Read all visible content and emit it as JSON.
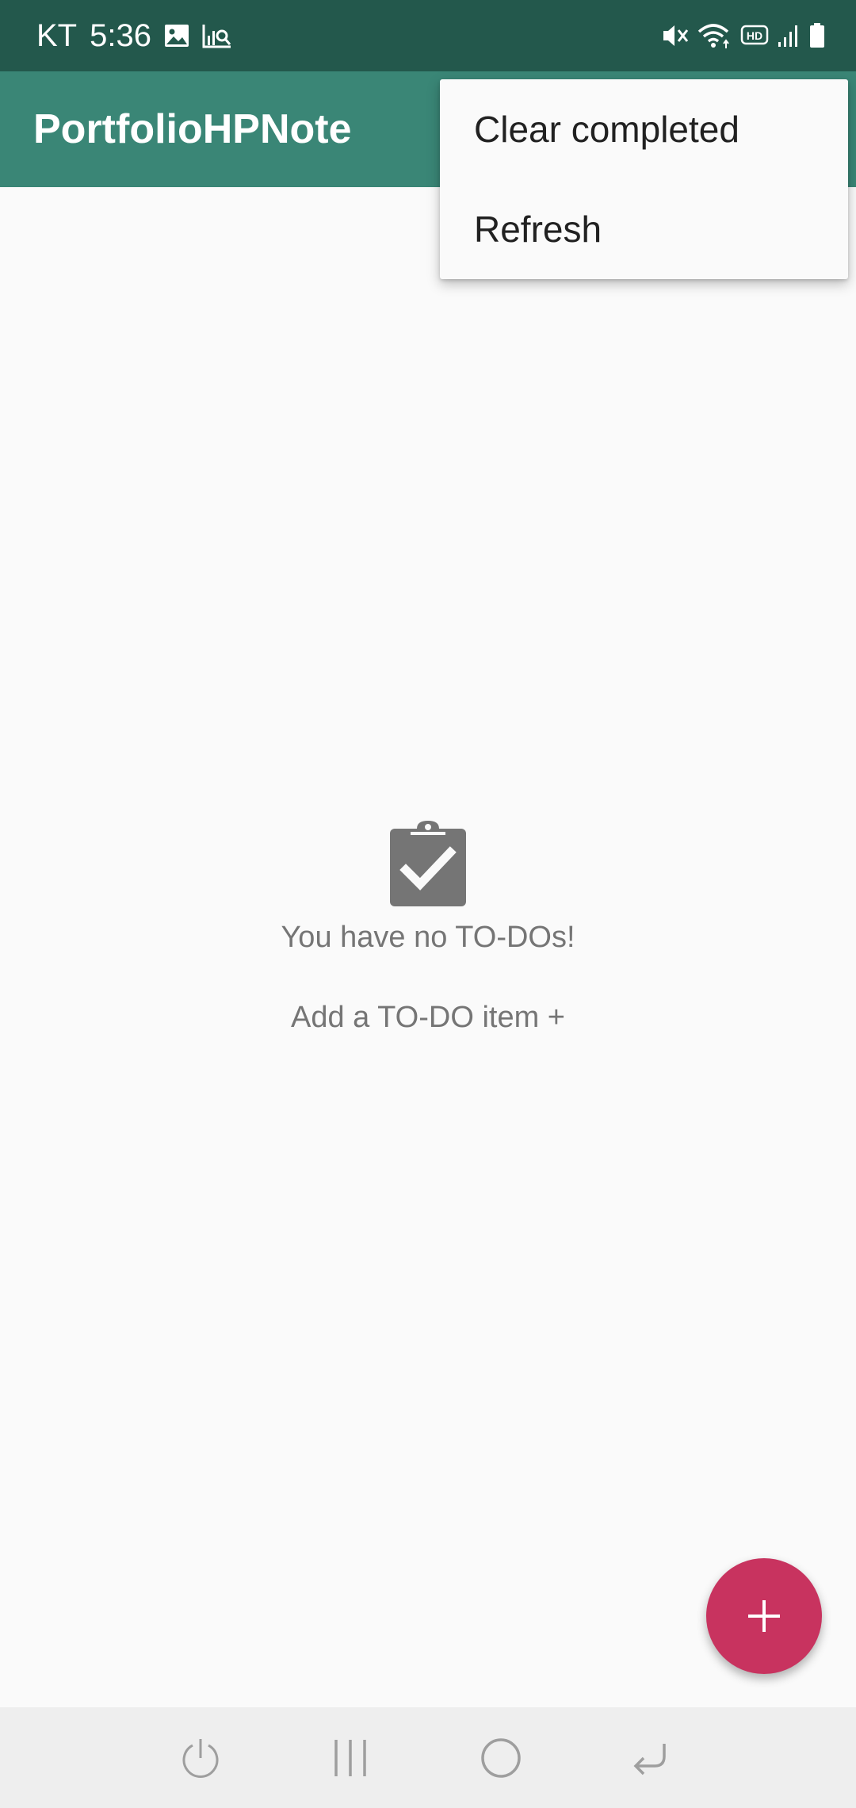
{
  "status_bar": {
    "carrier": "KT",
    "time": "5:36",
    "left_icons": [
      "image-icon",
      "analytics-search-icon"
    ],
    "right_icons": [
      "vibrate-mute-icon",
      "wifi-icon",
      "hd-icon",
      "signal-icon",
      "battery-icon"
    ]
  },
  "app_bar": {
    "title": "PortfolioHPNote"
  },
  "overflow_menu": {
    "items": [
      {
        "label": "Clear completed"
      },
      {
        "label": "Refresh"
      }
    ]
  },
  "empty_state": {
    "icon": "clipboard-check-icon",
    "message": "You have no TO-DOs!",
    "add_link": "Add a TO-DO item +"
  },
  "fab": {
    "icon": "plus-icon"
  },
  "nav_bar": {
    "buttons": [
      "power-icon",
      "recent-apps-icon",
      "home-icon",
      "back-icon"
    ]
  },
  "colors": {
    "status_bar": "#23584c",
    "app_bar": "#3a8676",
    "fab": "#c8335f",
    "background": "#fafafa",
    "nav_bar": "#eeeeee"
  }
}
